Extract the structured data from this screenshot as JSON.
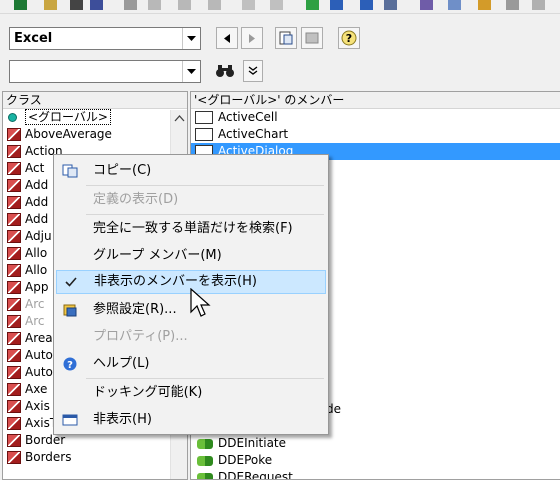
{
  "library_combo": {
    "value": "Excel"
  },
  "search_combo": {
    "value": ""
  },
  "left_panel": {
    "header": "クラス",
    "items": [
      "<グローバル>",
      "AboveAverage",
      "Action",
      "Act",
      "Add",
      "Add",
      "Add",
      "Adju",
      "Allo",
      "Allo",
      "App",
      "Arc",
      "Arc",
      "Area",
      "Auto",
      "Auto",
      "Axe",
      "Axis",
      "AxisTitle",
      "Border",
      "Borders"
    ]
  },
  "right_panel": {
    "header": "'<グローバル>' のメンバー",
    "items_top": [
      "ActiveCell",
      "ActiveChart",
      "ActiveDialog"
    ],
    "partial_de": "de",
    "items_bottom": [
      "DDEInitiate",
      "DDEPoke",
      "DDERequest"
    ]
  },
  "context_menu": {
    "items": [
      {
        "label": "コピー(C)",
        "enabled": true
      },
      {
        "label": "定義の表示(D)",
        "enabled": false
      },
      {
        "label": "完全に一致する単語だけを検索(F)",
        "enabled": true
      },
      {
        "label": "グループ メンバー(M)",
        "enabled": true
      },
      {
        "label": "非表示のメンバーを表示(H)",
        "enabled": true,
        "checked": true,
        "highlighted": true
      },
      {
        "label": "参照設定(R)...",
        "enabled": true
      },
      {
        "label": "プロパティ(P)...",
        "enabled": false
      },
      {
        "label": "ヘルプ(L)",
        "enabled": true
      },
      {
        "label": "ドッキング可能(K)",
        "enabled": true
      },
      {
        "label": "非表示(H)",
        "enabled": true
      }
    ]
  },
  "colors": {
    "selection": "#3399ff",
    "menu_highlight": "#cce8ff"
  }
}
